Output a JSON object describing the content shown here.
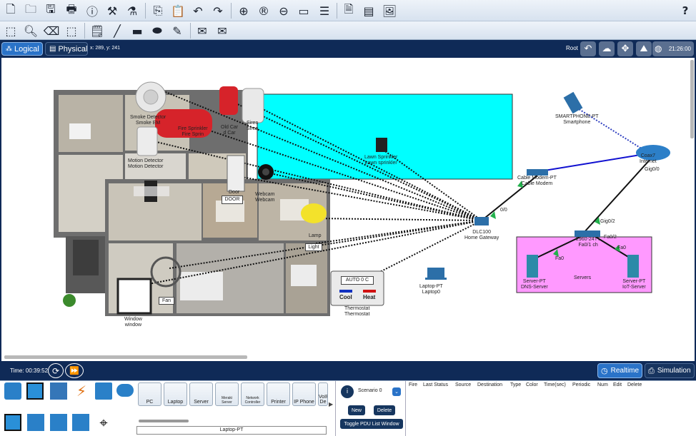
{
  "toolbar": {
    "help_label": "?"
  },
  "nav": {
    "logical_label": "Logical",
    "physical_label": "Physical",
    "coords_text": "x: 289, y: 241",
    "root_label": "Root",
    "clock_text": "21:26:00"
  },
  "canvas": {
    "labels": {
      "smoke_detector": "Smoke Detector",
      "smoke_em": "Smoke EM",
      "fire_sprinkler": "Fire Sprinkler",
      "fire_sprinkler2": "Fire Sprin",
      "old_car": "Old Car",
      "old_car2": "d Car",
      "siren": "Siren",
      "siren2": "Siren",
      "motion_detector1": "Motion Detector",
      "motion_detector2": "Motion Detector",
      "lawn_sprinkler1": "Lawn Sprinkler",
      "lawn_sprinkler2": "Lawn sprinkler",
      "door_small": "Door",
      "door_box": "DOOR",
      "webcam1": "Webcam",
      "webcam2": "Webcam",
      "lamp": "Lamp",
      "light": "Light",
      "fan": "Fan",
      "window1": "Window",
      "window2": "window",
      "thermostat_mode": "AUTO  0 C",
      "cool": "Cool",
      "heat": "Heat",
      "thermostat1": "Thermostat",
      "thermostat2": "Thermostat",
      "gateway1": "DLC100",
      "gateway2": "Home Gateway",
      "gateway_port": "0/0",
      "laptop1": "Laptop-PT",
      "laptop2": "Laptop0",
      "cable_modem1": "Cable Modem-PT",
      "cable_modem2": "Cable Modem",
      "smartphone1": "SMARTPHONE-PT",
      "smartphone2": "Smartphone",
      "internet1": "Coax7",
      "internet2": "Internet",
      "internet_port": "Gig0/0",
      "switch_port_up": "Gig0/2",
      "switch1": "2960-24TT",
      "switch2": "Fa0/1 ch",
      "switch_port_right": "Fa0/2",
      "port_fa0_left": "Fa0",
      "port_fa0_right": "Fa0",
      "servers_label": "Servers",
      "dns1": "Server-PT",
      "dns2": "DNS-Server",
      "iot1": "Server-PT",
      "iot2": "IoT-Server",
      "door_label_bold": "DOOR"
    }
  },
  "status": {
    "time_label": "Time: 00:39:52",
    "realtime_label": "Realtime",
    "simulation_label": "Simulation"
  },
  "devices": {
    "tiles": [
      "PC",
      "Laptop",
      "Server",
      "Meraki Server",
      "Network Controller",
      "Printer",
      "IP Phone",
      "VoIP De"
    ],
    "selected_name": "Laptop-PT"
  },
  "scenario": {
    "value": "Scenario 0",
    "new_label": "New",
    "delete_label": "Delete",
    "toggle_label": "Toggle PDU List Window"
  },
  "pdu_columns": [
    "Fire",
    "Last Status",
    "Source",
    "Destination",
    "Type",
    "Color",
    "Time(sec)",
    "Periodic",
    "Num",
    "Edit",
    "Delete"
  ],
  "colors": {
    "nav_bg": "#0f2a57",
    "cyan_zone": "#00ffff",
    "server_zone": "#ff99ff",
    "link_blue": "#1010d0"
  }
}
